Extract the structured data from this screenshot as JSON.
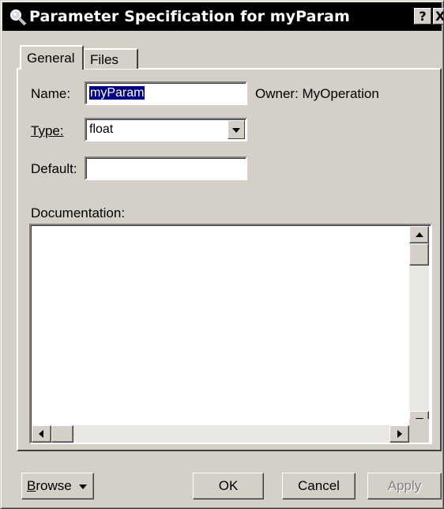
{
  "window": {
    "title": "Parameter Specification for myParam",
    "help_label": "?",
    "close_label": "X"
  },
  "tabs": [
    {
      "label": "General",
      "active": true
    },
    {
      "label": "Files",
      "active": false
    }
  ],
  "general": {
    "name_label": "Name:",
    "name_value": "myParam",
    "owner_text": "Owner:  MyOperation",
    "type_label_first": "T",
    "type_label_rest": "ype:",
    "type_value": "float",
    "default_label": "Default:",
    "default_value": "",
    "documentation_label": "Documentation:",
    "documentation_value": ""
  },
  "buttons": {
    "browse_first": "B",
    "browse_rest": "rowse",
    "ok": "OK",
    "cancel": "Cancel",
    "apply": "Apply"
  },
  "icons": {
    "title": "magnifier-icon",
    "type_dropdown": "chevron-down-icon",
    "browse_dropdown": "chevron-down-icon"
  }
}
